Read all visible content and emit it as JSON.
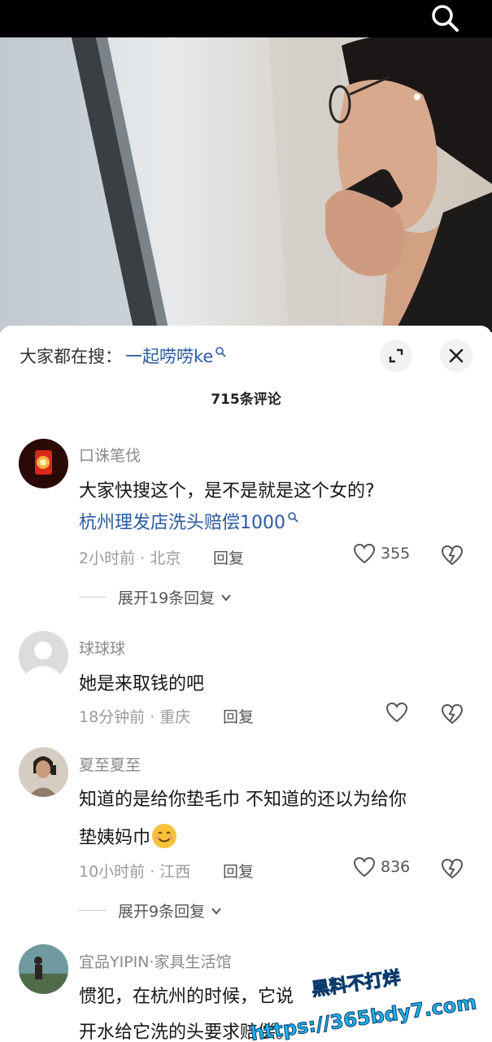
{
  "search_bar": {
    "icon": "search-icon"
  },
  "video": {
    "description": ""
  },
  "header": {
    "hot_label": "大家都在搜：",
    "hot_keyword": "一起唠唠ke",
    "comment_count": "715条评论"
  },
  "comments": [
    {
      "user": "口诛笔伐",
      "text": "大家快搜这个，是不是就是这个女的?",
      "link": "杭州理发店洗头赔偿1000",
      "meta": "2小时前 · 北京",
      "reply": "回复",
      "likes": "355",
      "expand": "展开19条回复"
    },
    {
      "user": "球球球",
      "text": "她是来取钱的吧",
      "meta": "18分钟前 · 重庆",
      "reply": "回复",
      "likes": ""
    },
    {
      "user": "夏至夏至",
      "text_line1": "知道的是给你垫毛巾 不知道的还以为给你",
      "text_line2": "垫姨妈巾",
      "meta": "10小时前 · 江西",
      "reply": "回复",
      "likes": "836",
      "expand": "展开9条回复"
    },
    {
      "user": "宜品YIPIN·家具生活馆",
      "text_line1": "惯犯，在杭州的时候，它说",
      "text_line2": "开水给它洗的头要求赔偿。"
    }
  ],
  "watermark": {
    "line1": "黑料不打烊",
    "line2": "https://365bdy7.com"
  },
  "colors": {
    "link": "#2c5aa0",
    "meta": "#9a9a9a",
    "watermark": "#1db4e8"
  }
}
